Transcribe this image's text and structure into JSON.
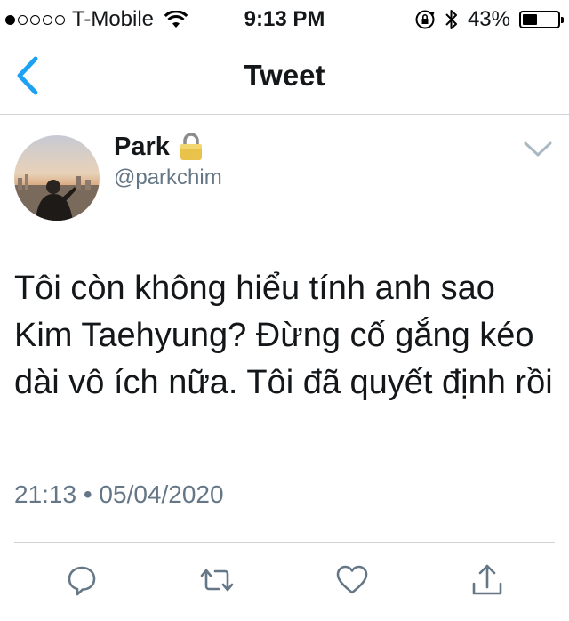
{
  "status_bar": {
    "carrier": "T-Mobile",
    "time": "9:13 PM",
    "battery_percent": "43%",
    "battery_level": 0.43,
    "signal_bars_filled": 1,
    "signal_bars_total": 5
  },
  "nav": {
    "title": "Tweet"
  },
  "tweet": {
    "author_name": "Park",
    "author_handle": "@parkchim",
    "text": "Tôi còn không hiểu tính anh sao Kim Taehyung? Đừng cố gắng kéo dài vô ích nữa. Tôi đã quyết định rồi",
    "timestamp": "21:13 • 05/04/2020"
  },
  "colors": {
    "accent": "#1da1f2",
    "secondary_text": "#657786",
    "divider": "#d0d3d6"
  },
  "icons": {
    "back": "chevron-left-icon",
    "lock": "lock-icon",
    "more": "chevron-down-icon",
    "reply": "reply-icon",
    "retweet": "retweet-icon",
    "like": "heart-icon",
    "share": "share-icon"
  }
}
